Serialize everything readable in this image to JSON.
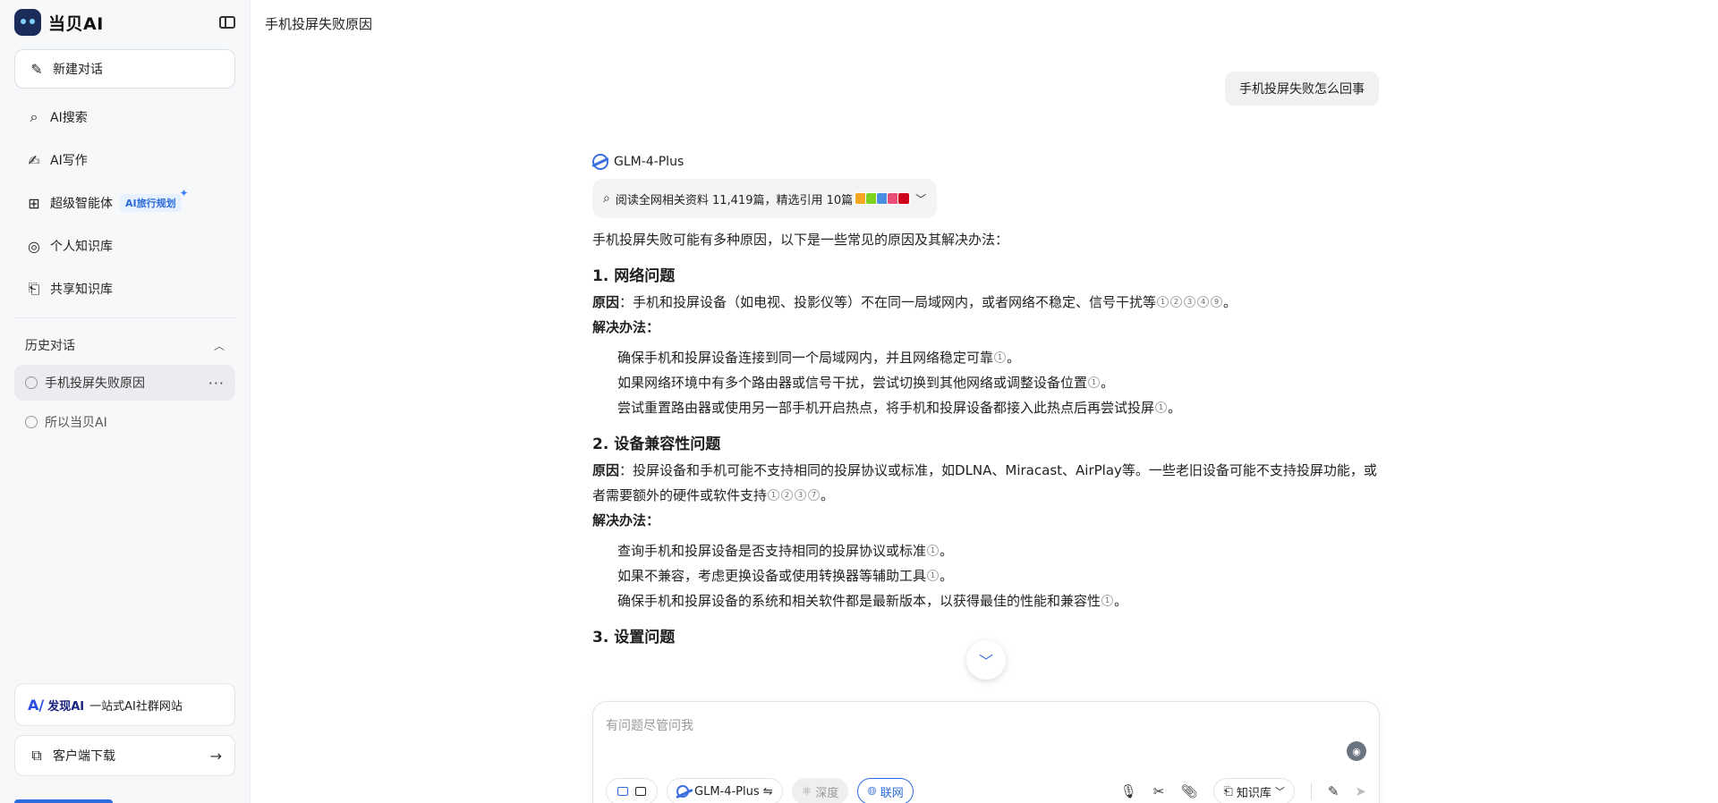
{
  "app": {
    "name": "当贝AI"
  },
  "sidebar": {
    "new_chat": "新建对话",
    "nav": [
      {
        "label": "AI搜索"
      },
      {
        "label": "AI写作"
      },
      {
        "label": "超级智能体",
        "badge": "AI旅行规划"
      },
      {
        "label": "个人知识库"
      },
      {
        "label": "共享知识库"
      }
    ],
    "history_title": "历史对话",
    "history": [
      {
        "label": "手机投屏失败原因",
        "more": "···"
      },
      {
        "label": "所以当贝AI"
      }
    ],
    "promo": {
      "brand": "发现AI",
      "text": "一站式AI社群网站"
    },
    "download": "客户端下载"
  },
  "main": {
    "page_title": "手机投屏失败原因",
    "user_message": "手机投屏失败怎么回事",
    "model_name": "GLM-4-Plus",
    "refs_text": "阅读全网相关资料 11,419篇，精选引用 10篇",
    "intro": "手机投屏失败可能有多种原因，以下是一些常见的原因及其解决办法：",
    "sections": [
      {
        "title": "1. 网络问题",
        "cause_label": "原因",
        "cause": "：手机和投屏设备（如电视、投影仪等）不在同一局域网内，或者网络不稳定、信号干扰等",
        "cause_cites": [
          "1",
          "2",
          "3",
          "4",
          "9"
        ],
        "fix_label": "解决办法",
        "fixes": [
          {
            "text": "确保手机和投屏设备连接到同一个局域网内，并且网络稳定可靠",
            "cite": "1"
          },
          {
            "text": "如果网络环境中有多个路由器或信号干扰，尝试切换到其他网络或调整设备位置",
            "cite": "1"
          },
          {
            "text": "尝试重置路由器或使用另一部手机开启热点，将手机和投屏设备都接入此热点后再尝试投屏",
            "cite": "1"
          }
        ]
      },
      {
        "title": "2. 设备兼容性问题",
        "cause_label": "原因",
        "cause": "：投屏设备和手机可能不支持相同的投屏协议或标准，如DLNA、Miracast、AirPlay等。一些老旧设备可能不支持投屏功能，或者需要额外的硬件或软件支持",
        "cause_cites": [
          "1",
          "2",
          "3",
          "7"
        ],
        "fix_label": "解决办法",
        "fixes": [
          {
            "text": "查询手机和投屏设备是否支持相同的投屏协议或标准",
            "cite": "1"
          },
          {
            "text": "如果不兼容，考虑更换设备或使用转换器等辅助工具",
            "cite": "1"
          },
          {
            "text": "确保手机和投屏设备的系统和相关软件都是最新版本，以获得最佳的性能和兼容性",
            "cite": "1"
          }
        ]
      },
      {
        "title": "3. 设置问题"
      }
    ]
  },
  "composer": {
    "placeholder": "有问题尽管问我",
    "model_pill": "GLM-4-Plus ⇋",
    "deep_label": "深度",
    "web_label": "联网",
    "kb_label": "知识库"
  },
  "colors": {
    "accent": "#2f6be0",
    "sidebar_bg": "#f7f8fa"
  }
}
